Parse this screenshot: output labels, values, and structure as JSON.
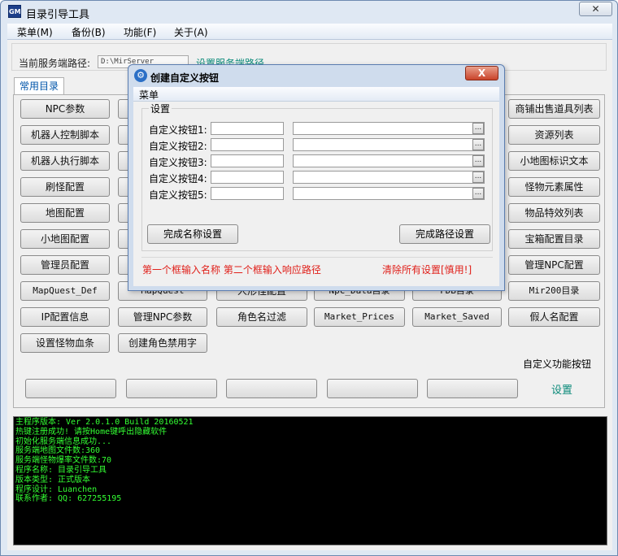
{
  "app": {
    "title": "目录引导工具",
    "icon_text": "GM",
    "close_glyph": "✕"
  },
  "menubar": [
    {
      "label": "菜单(M)"
    },
    {
      "label": "备份(B)"
    },
    {
      "label": "功能(F)"
    },
    {
      "label": "关于(A)"
    }
  ],
  "server_path": {
    "label": "当前服务端路径:",
    "value": "D:\\MirServer",
    "set_link": "设置服务端路径"
  },
  "tabs": [
    {
      "label": "常用目录"
    }
  ],
  "buttons": {
    "row1": [
      "NPC参数",
      "",
      "",
      "",
      "",
      "商铺出售道具列表"
    ],
    "row2": [
      "机器人控制脚本",
      "",
      "",
      "",
      "",
      "资源列表"
    ],
    "row3": [
      "机器人执行脚本",
      "",
      "",
      "",
      "",
      "小地图标识文本"
    ],
    "row4": [
      "刷怪配置",
      "",
      "",
      "",
      "",
      "怪物元素属性"
    ],
    "row5": [
      "地图配置",
      "",
      "",
      "",
      "",
      "物品特效列表"
    ],
    "row6": [
      "小地图配置",
      "",
      "",
      "",
      "",
      "宝箱配置目录"
    ],
    "row7": [
      "管理员配置",
      "",
      "",
      "",
      "",
      "管理NPC配置"
    ],
    "row8": [
      "MapQuest_Def",
      "MapQuest",
      "人形怪配置",
      "Npc_Data目录",
      "FDB目录",
      "Mir200目录"
    ],
    "row9": [
      "IP配置信息",
      "管理NPC参数",
      "角色名过滤",
      "Market_Prices",
      "Market_Saved",
      "假人名配置"
    ],
    "row10": [
      "设置怪物血条",
      "创建角色禁用字"
    ]
  },
  "custom_section": {
    "label": "自定义功能按钮",
    "buttons": [
      "",
      "",
      "",
      "",
      ""
    ],
    "settings_link": "设置"
  },
  "console": [
    "主程序版本: Ver 2.0.1.0 Build 20160521",
    "热键注册成功! 请按Home键呼出隐藏软件",
    "初始化服务端信息成功...",
    "服务端地图文件数:360",
    "服务端怪物爆率文件数:70",
    "程序名称: 目录引导工具",
    "版本类型: 正式版本",
    "程序设计: Luanchen",
    "联系作者: QQ: 627255195"
  ],
  "colors": {
    "console_text": "#33ff33",
    "link": "#0b8a7a",
    "hint": "#e0201a"
  },
  "dialog": {
    "title": "创建自定义按钮",
    "close_glyph": "X",
    "menu": "菜单",
    "group_label": "设置",
    "rows": [
      {
        "label": "自定义按钮1:",
        "name": "",
        "path": ""
      },
      {
        "label": "自定义按钮2:",
        "name": "",
        "path": ""
      },
      {
        "label": "自定义按钮3:",
        "name": "",
        "path": ""
      },
      {
        "label": "自定义按钮4:",
        "name": "",
        "path": ""
      },
      {
        "label": "自定义按钮5:",
        "name": "",
        "path": ""
      }
    ],
    "browse_glyph": "...",
    "finish_name_btn": "完成名称设置",
    "finish_path_btn": "完成路径设置",
    "hint_left": "第一个框输入名称 第二个框输入响应路径",
    "hint_right": "清除所有设置[慎用!]"
  }
}
